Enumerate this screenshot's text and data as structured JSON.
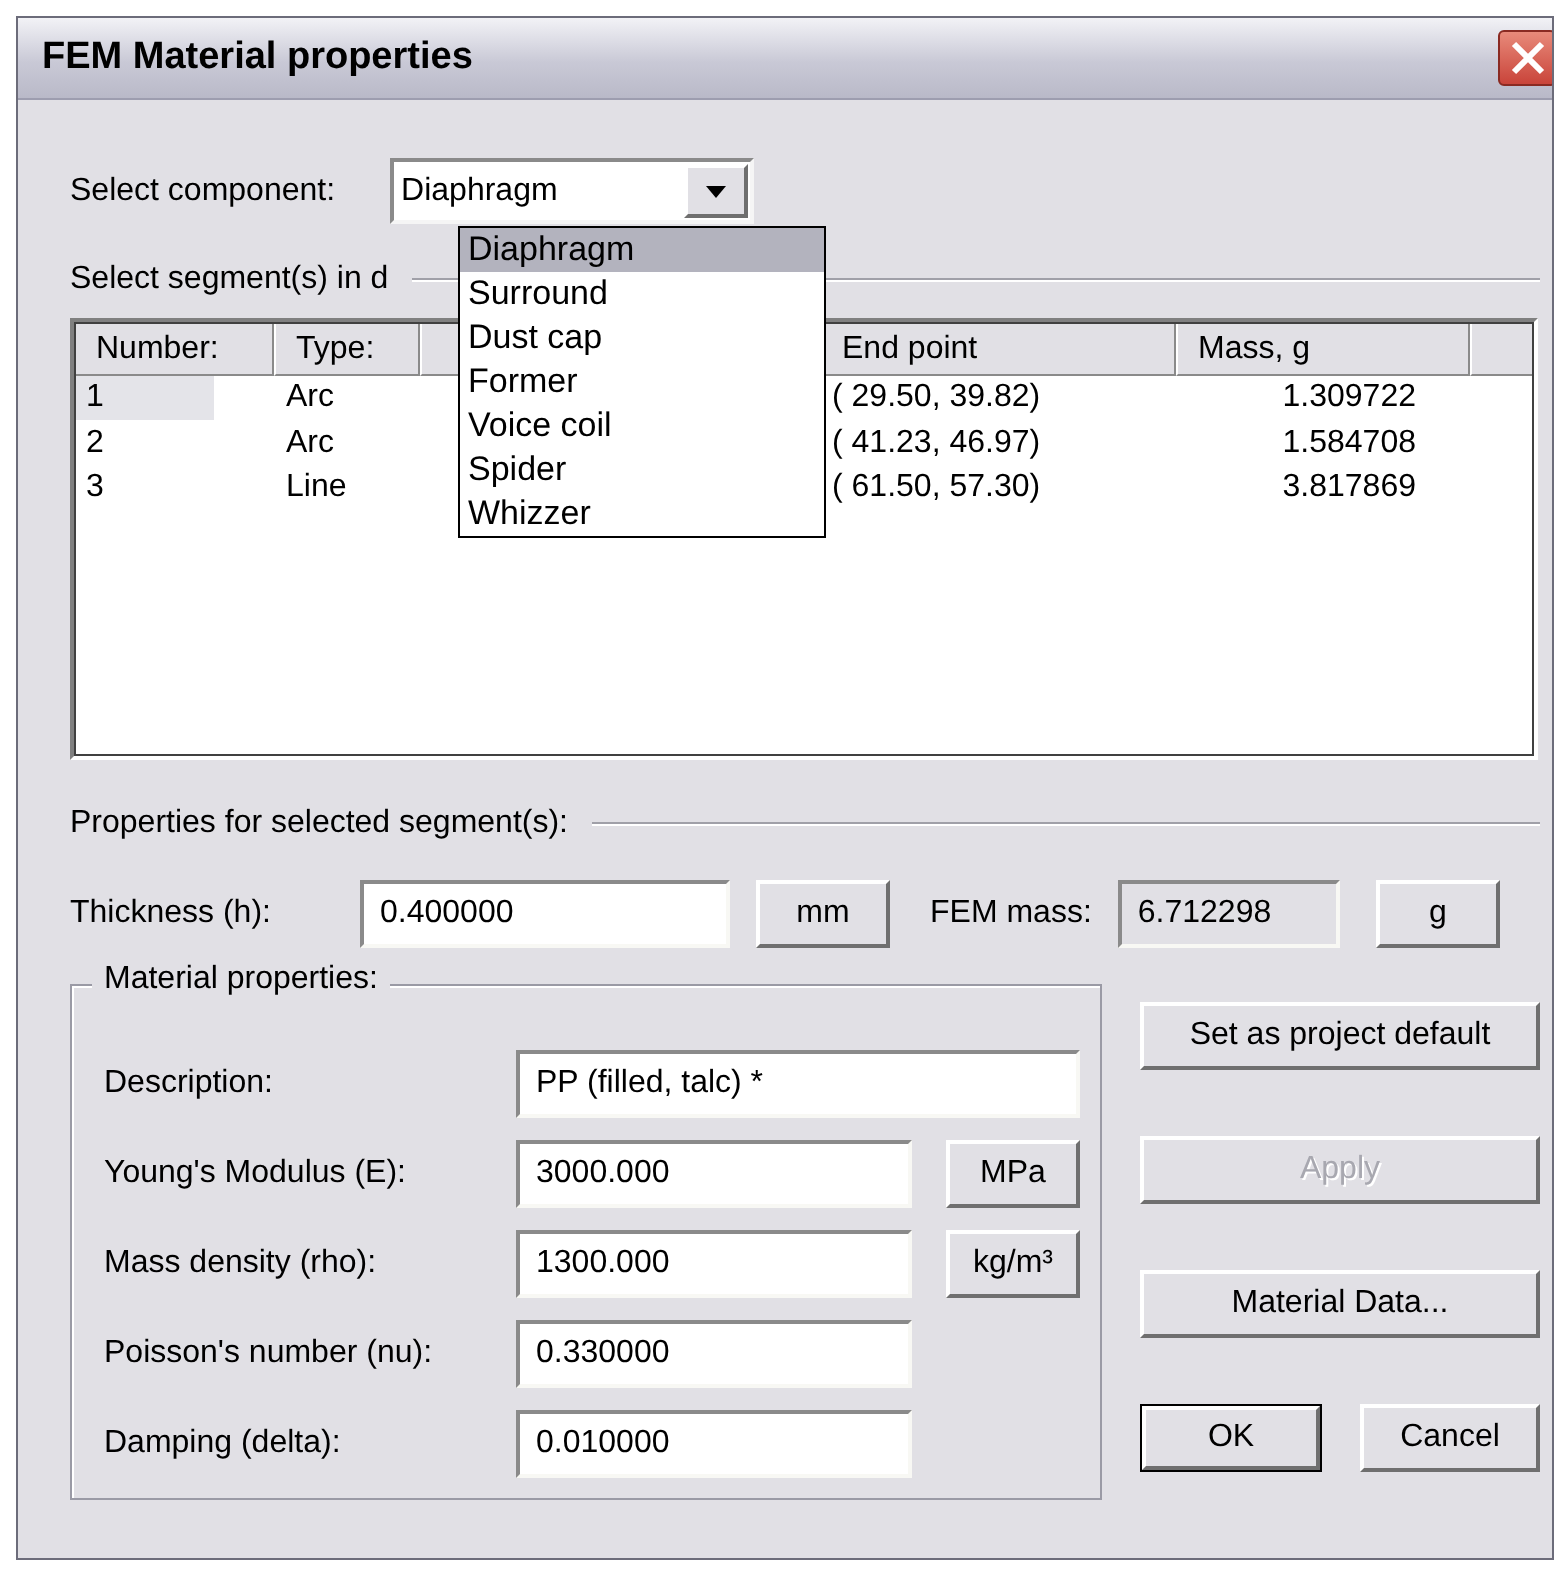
{
  "window": {
    "title": "FEM Material properties"
  },
  "component": {
    "label": "Select component:",
    "value": "Diaphragm",
    "expanded": true,
    "options": [
      {
        "label": "Diaphragm",
        "selected": true
      },
      {
        "label": "Surround",
        "selected": false
      },
      {
        "label": "Dust cap",
        "selected": false
      },
      {
        "label": "Former",
        "selected": false
      },
      {
        "label": "Voice coil",
        "selected": false
      },
      {
        "label": "Spider",
        "selected": false
      },
      {
        "label": "Whizzer",
        "selected": false
      }
    ]
  },
  "segments": {
    "label": "Select segment(s) in d",
    "columns": [
      "Number:",
      "Type:",
      "End point",
      "Mass, g"
    ],
    "rows": [
      {
        "cells": [
          "1",
          "Arc",
          "( 29.50, 39.82)",
          "1.309722"
        ],
        "selected": true
      },
      {
        "cells": [
          "2",
          "Arc",
          "( 41.23, 46.97)",
          "1.584708"
        ],
        "selected": false
      },
      {
        "cells": [
          "3",
          "Line",
          "( 61.50, 57.30)",
          "3.817869"
        ],
        "selected": false
      }
    ]
  },
  "properties": {
    "label": "Properties for selected segment(s):",
    "thickness": {
      "label": "Thickness (h):",
      "value": "0.400000",
      "unit": "mm"
    },
    "fem_mass": {
      "label": "FEM mass:",
      "value": "6.712298",
      "unit": "g"
    }
  },
  "material": {
    "legend": "Material properties:",
    "fields": [
      {
        "label": "Description:",
        "value": "PP (filled, talc) *"
      },
      {
        "label": "Young's Modulus (E):",
        "value": "3000.000",
        "unit": "MPa"
      },
      {
        "label": "Mass density (rho):",
        "value": "1300.000",
        "unit": "kg/m³"
      },
      {
        "label": "Poisson's number (nu):",
        "value": "0.330000"
      },
      {
        "label": "Damping (delta):",
        "value": "0.010000"
      }
    ]
  },
  "side_buttons": [
    {
      "label": "Set as project default",
      "disabled": false
    },
    {
      "label": "Apply",
      "disabled": true
    },
    {
      "label": "Material Data...",
      "disabled": false
    }
  ],
  "footer_buttons": [
    {
      "label": "OK",
      "default": true
    },
    {
      "label": "Cancel",
      "default": false
    }
  ]
}
